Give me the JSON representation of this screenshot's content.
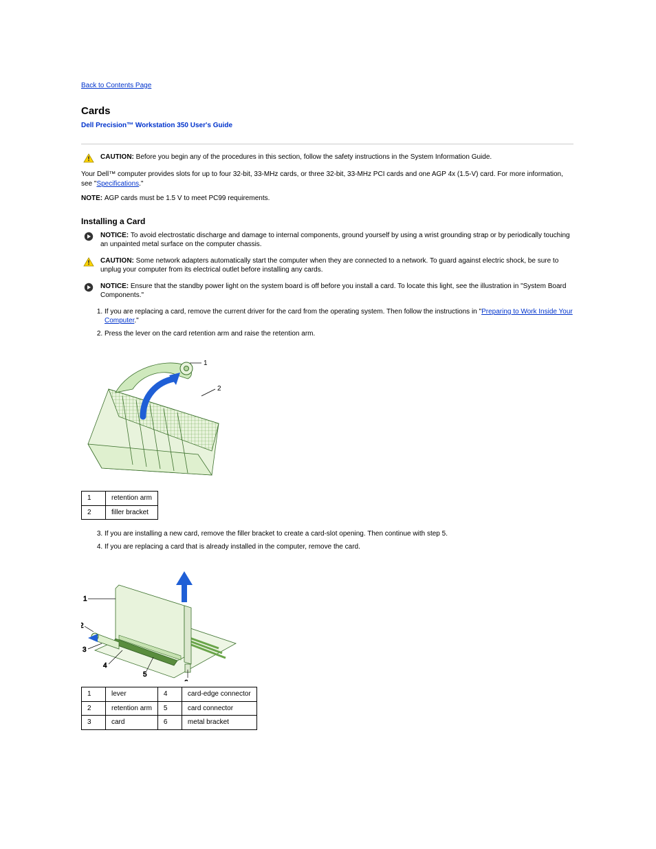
{
  "nav": {
    "back": "Back to Contents Page"
  },
  "header": {
    "title": "Cards",
    "guide": "Dell Precision™ Workstation 350 User's Guide"
  },
  "caution1": {
    "label": "CAUTION: ",
    "text": "Before you begin any of the procedures in this section, follow the safety instructions in the System Information Guide."
  },
  "intro": {
    "p1_a": "Your Dell™ computer provides slots for up to four 32-bit, 33-MHz cards, or three 32-bit, 33-MHz PCI cards and one AGP 4x (1.5-V) card. For more information, see \"",
    "p1_link": "Specifications",
    "p1_b": ".\"",
    "note_label": "NOTE: ",
    "note_text": "AGP cards must be 1.5 V to meet PC99 requirements."
  },
  "install": {
    "heading": "Installing a Card",
    "notice1_label": "NOTICE: ",
    "notice1_text": "To avoid electrostatic discharge and damage to internal components, ground yourself by using a wrist grounding strap or by periodically touching an unpainted metal surface on the computer chassis.",
    "caution_label": "CAUTION: ",
    "caution_text": "Some network adapters automatically start the computer when they are connected to a network. To guard against electric shock, be sure to unplug your computer from its electrical outlet before installing any cards.",
    "notice2_label": "NOTICE: ",
    "notice2_text": "Ensure that the standby power light on the system board is off before you install a card. To locate this light, see the illustration in \"System Board Components.\"",
    "step1_a": "If you are replacing a card, remove the current driver for the card from the operating system. Then follow the instructions in \"",
    "step1_link": "Preparing to Work Inside Your Computer",
    "step1_b": ".\"",
    "step2": "Press the lever on the card retention arm and raise the retention arm.",
    "step3": "If you are installing a new card, remove the filler bracket to create a card-slot opening. Then continue with step 5.",
    "step4": "If you are replacing a card that is already installed in the computer, remove the card."
  },
  "fig1": {
    "r1n": "1",
    "r1t": "retention arm",
    "r2n": "2",
    "r2t": "filler bracket"
  },
  "fig2": {
    "r1c1n": "1",
    "r1c1t": "lever",
    "r1c2n": "4",
    "r1c2t": "card-edge connector",
    "r2c1n": "2",
    "r2c1t": "retention arm",
    "r2c2n": "5",
    "r2c2t": "card connector",
    "r3c1n": "3",
    "r3c1t": "card",
    "r3c2n": "6",
    "r3c2t": "metal bracket"
  }
}
